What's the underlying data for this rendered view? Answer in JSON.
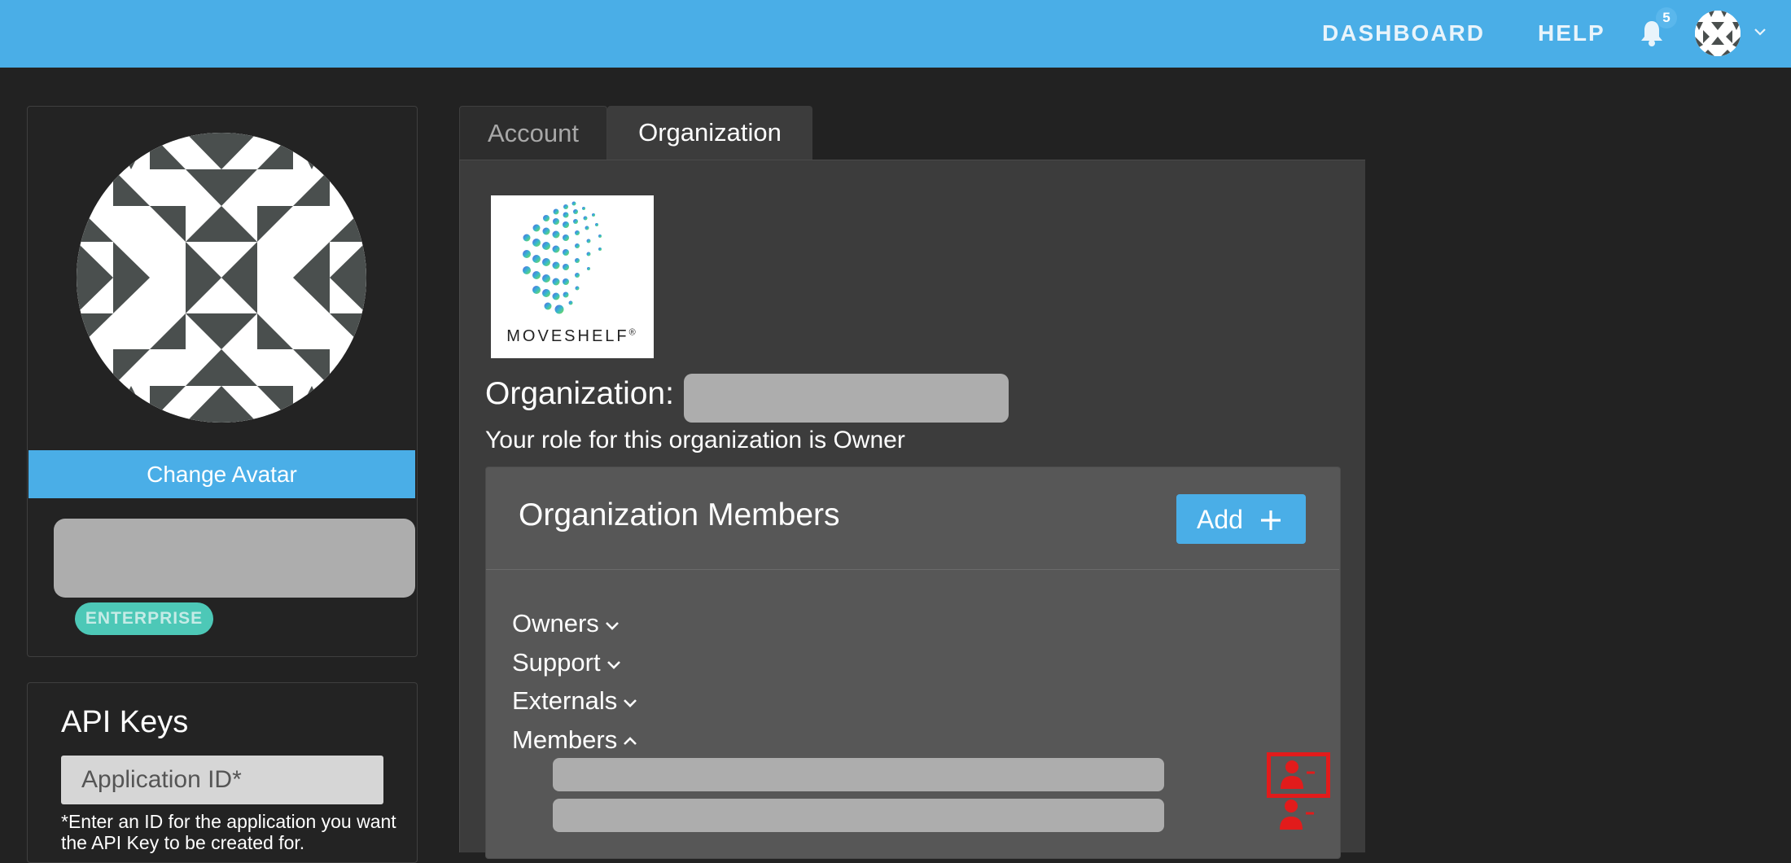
{
  "navbar": {
    "dashboard_label": "DASHBOARD",
    "help_label": "HELP",
    "notification_count": "5",
    "brand_color": "#4aaee7"
  },
  "profile": {
    "change_avatar_label": "Change Avatar",
    "plan_badge": "ENTERPRISE"
  },
  "api_keys": {
    "title": "API Keys",
    "app_id_placeholder": "Application ID*",
    "help_text": "*Enter an ID for the application you want the API Key to be created for."
  },
  "tabs": [
    {
      "label": "Account",
      "active": false
    },
    {
      "label": "Organization",
      "active": true
    }
  ],
  "organization": {
    "logo_text": "MOVESHELF",
    "logo_mark": "®",
    "label": "Organization:",
    "role_text": "Your role for this organization is Owner"
  },
  "members": {
    "title": "Organization Members",
    "add_label": "Add",
    "groups": [
      {
        "label": "Owners",
        "expanded": false
      },
      {
        "label": "Support",
        "expanded": false
      },
      {
        "label": "Externals",
        "expanded": false
      },
      {
        "label": "Members",
        "expanded": true
      }
    ],
    "remove_icon_color": "#e21b1b"
  }
}
